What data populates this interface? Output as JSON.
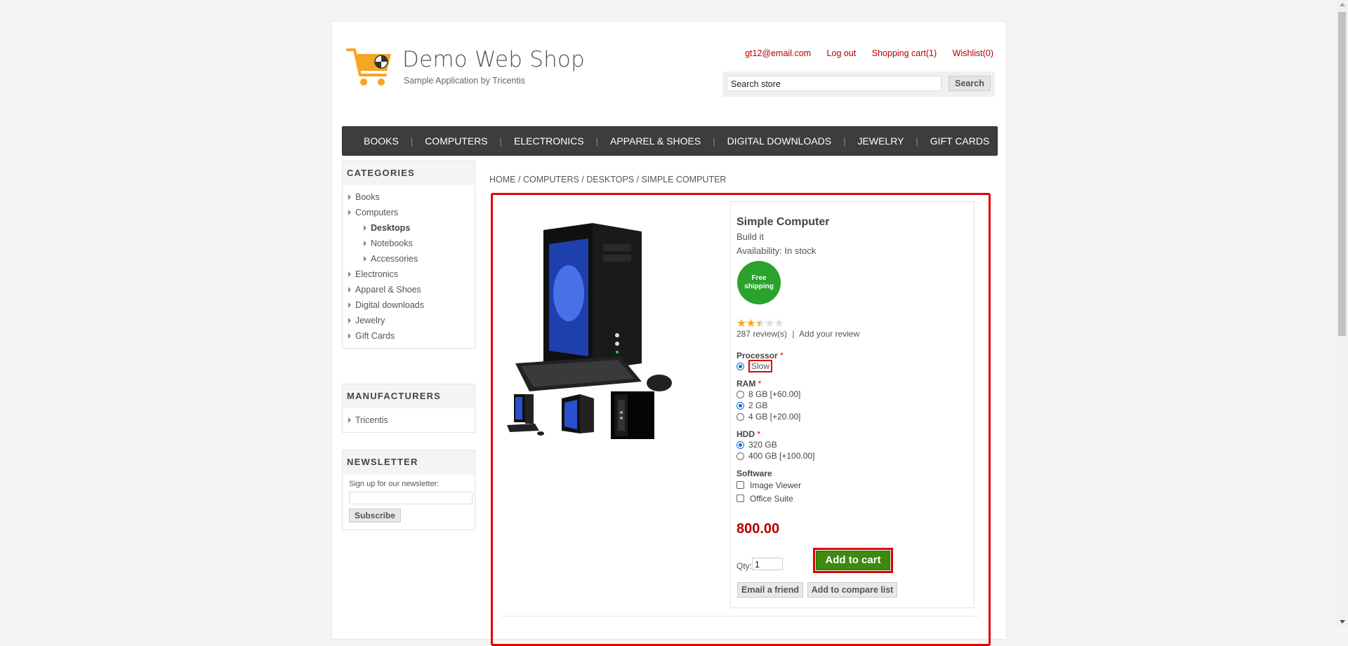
{
  "header": {
    "title": "Demo Web Shop",
    "subtitle": "Sample Application by Tricentis",
    "links": {
      "account": "gt12@email.com",
      "logout": "Log out",
      "cart": "Shopping cart(1)",
      "wishlist": "Wishlist(0)"
    },
    "search": {
      "value": "Search store",
      "button": "Search"
    }
  },
  "nav": [
    "BOOKS",
    "COMPUTERS",
    "ELECTRONICS",
    "APPAREL & SHOES",
    "DIGITAL DOWNLOADS",
    "JEWELRY",
    "GIFT CARDS"
  ],
  "sidebar": {
    "categories_title": "CATEGORIES",
    "categories": {
      "books": "Books",
      "computers": "Computers",
      "desktops": "Desktops",
      "notebooks": "Notebooks",
      "accessories": "Accessories",
      "electronics": "Electronics",
      "apparel": "Apparel & Shoes",
      "digital": "Digital downloads",
      "jewelry": "Jewelry",
      "giftcards": "Gift Cards"
    },
    "manufacturers_title": "MANUFACTURERS",
    "manufacturers": [
      "Tricentis"
    ],
    "newsletter_title": "NEWSLETTER",
    "newsletter_label": "Sign up for our newsletter:",
    "newsletter_button": "Subscribe"
  },
  "breadcrumb": {
    "home": "HOME",
    "computers": "COMPUTERS",
    "desktops": "DESKTOPS",
    "current": "SIMPLE COMPUTER",
    "sep": "/"
  },
  "product": {
    "name": "Simple Computer",
    "short_description": "Build it",
    "availability": "Availability: In stock",
    "badge": "Free shipping",
    "rating_stars": 2.5,
    "reviews": "287 review(s)",
    "review_sep": "|",
    "add_review": "Add your review",
    "price": "800.00",
    "qty_label": "Qty:",
    "qty_value": "1",
    "add_to_cart": "Add to cart",
    "email_friend": "Email a friend",
    "compare": "Add to compare list",
    "attributes": {
      "processor": {
        "label": "Processor",
        "required": "*",
        "options": [
          "Slow"
        ],
        "selected": 0
      },
      "ram": {
        "label": "RAM",
        "required": "*",
        "options": [
          "8 GB [+60.00]",
          "2 GB",
          "4 GB [+20.00]"
        ],
        "selected": 1
      },
      "hdd": {
        "label": "HDD",
        "required": "*",
        "options": [
          "320 GB",
          "400 GB [+100.00]"
        ],
        "selected": 0
      },
      "software": {
        "label": "Software",
        "options": [
          "Image Viewer",
          "Office Suite"
        ]
      }
    }
  },
  "colors": {
    "accent": "#b30000",
    "highlight": "#e00000",
    "cart_button": "#3d8a0f",
    "nav_bg": "#3d3d3d",
    "badge": "#2ba22b"
  }
}
